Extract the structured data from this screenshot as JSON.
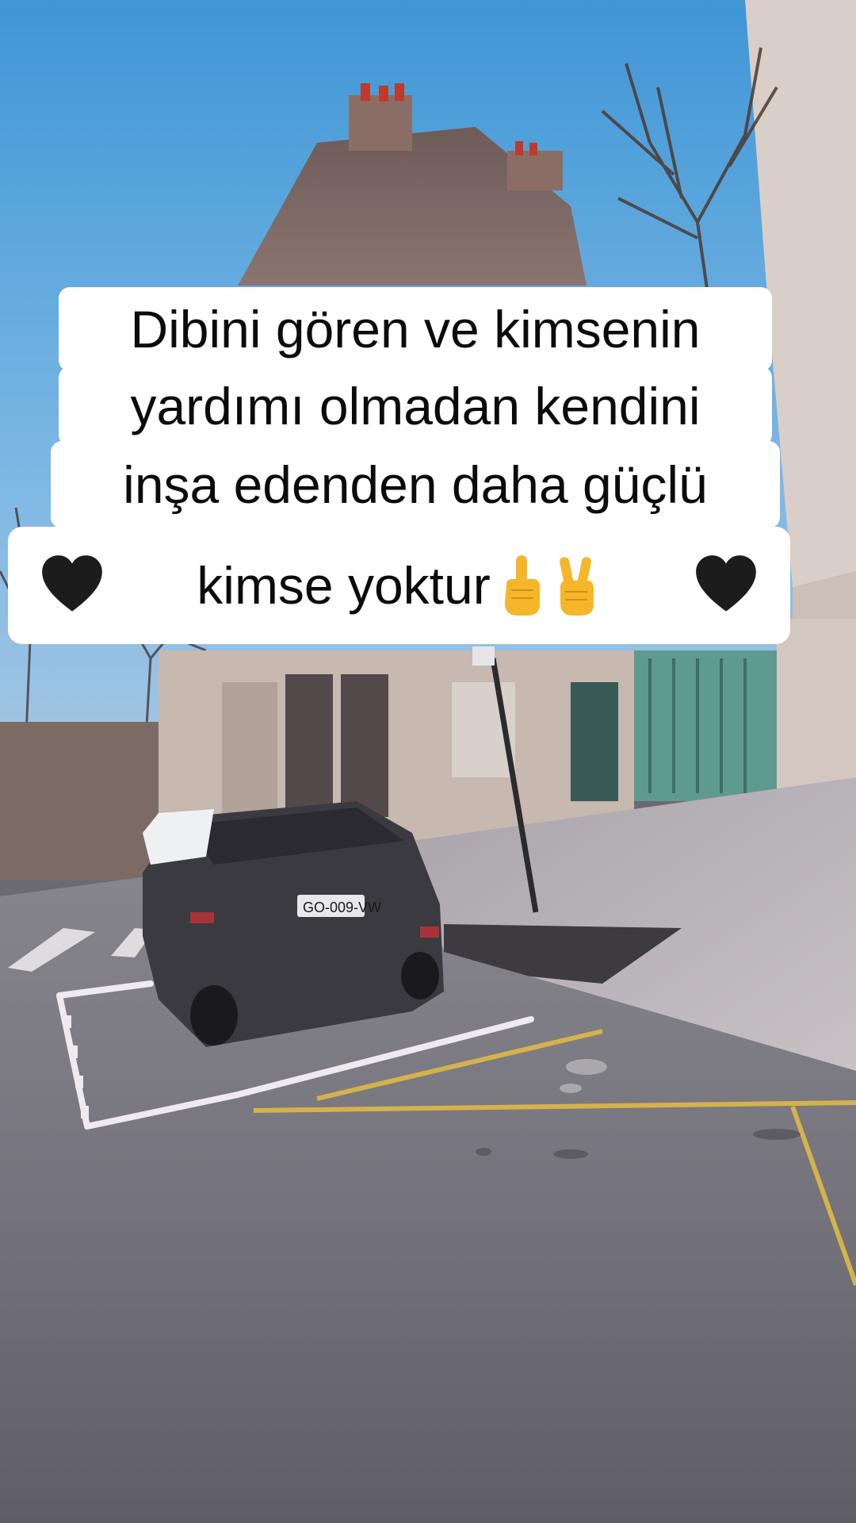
{
  "caption": {
    "line1": "Dibini gören ve kimsenin",
    "line2": "yardımı olmadan kendini",
    "line3": "inşa edenden daha güçlü",
    "line4": "kimse yoktur"
  },
  "icons": {
    "left_heart": "black-heart-icon",
    "right_heart": "black-heart-icon",
    "pointing_up": "index-pointing-up-icon",
    "victory": "victory-hand-icon"
  },
  "scene": {
    "license_plate": "GO-009-VW"
  },
  "colors": {
    "sky": "#4f9fd8",
    "caption_background": "#ffffff",
    "caption_text": "#0b0b0b",
    "heart": "#1c1c1c",
    "emoji_yellow": "#f5b72a"
  }
}
